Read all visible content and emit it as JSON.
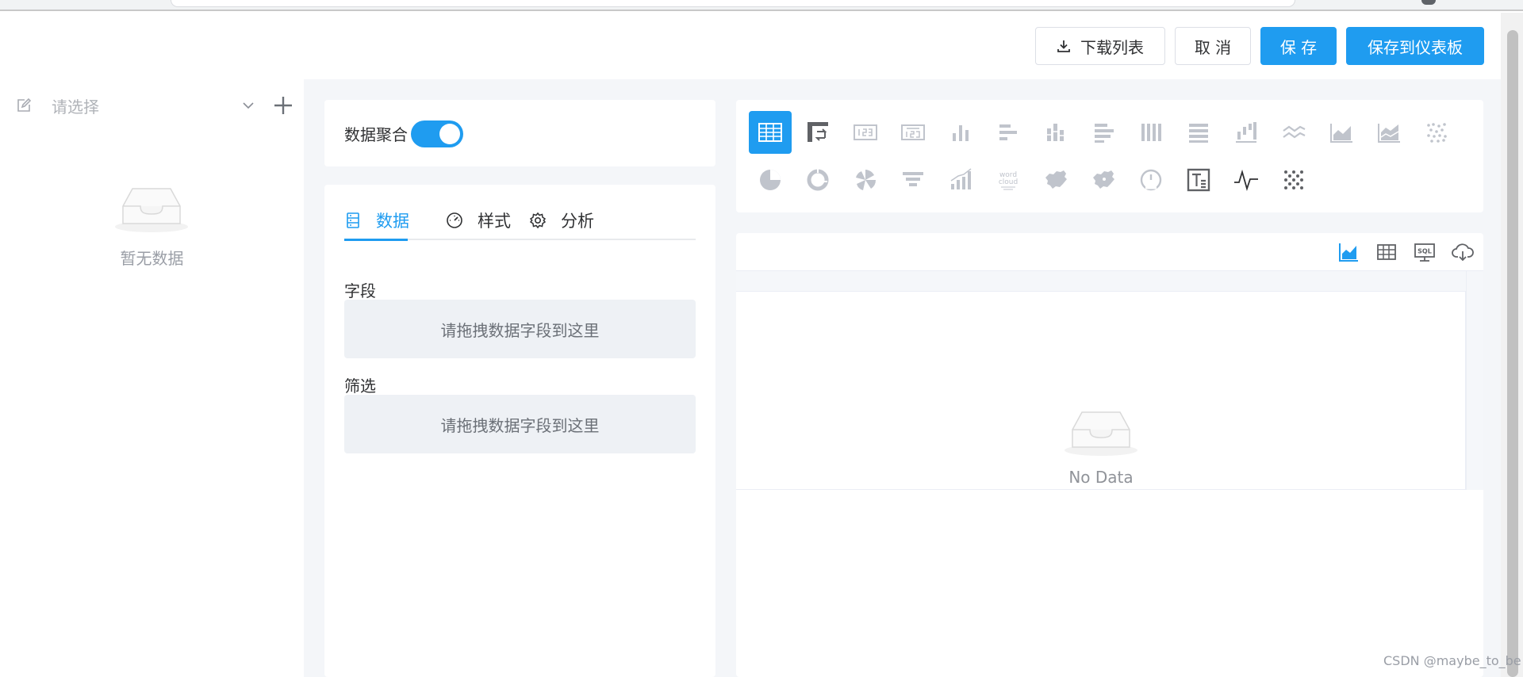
{
  "toolbar": {
    "download_label": "下载列表",
    "cancel_label": "取 消",
    "save_label": "保 存",
    "save_dashboard_label": "保存到仪表板"
  },
  "dataset": {
    "placeholder": "请选择",
    "empty_text": "暂无数据"
  },
  "aggregation": {
    "label": "数据聚合",
    "enabled": true
  },
  "config_tabs": [
    {
      "label": "数据",
      "icon": "database-icon",
      "active": true
    },
    {
      "label": "样式",
      "icon": "dashboard-gauge-icon",
      "active": false
    },
    {
      "label": "分析",
      "icon": "gear-icon",
      "active": false
    }
  ],
  "fields": {
    "field_label": "字段",
    "field_drop": "请拖拽数据字段到这里",
    "filter_label": "筛选",
    "filter_drop": "请拖拽数据字段到这里"
  },
  "chart_types": [
    {
      "icon": "table-icon",
      "active": true
    },
    {
      "icon": "pivot-table-icon"
    },
    {
      "icon": "kpi-number-icon"
    },
    {
      "icon": "kpi-compare-icon"
    },
    {
      "icon": "bar-chart-icon"
    },
    {
      "icon": "horizontal-bar-icon"
    },
    {
      "icon": "stacked-bar-icon"
    },
    {
      "icon": "horizontal-stacked-bar-icon"
    },
    {
      "icon": "percent-bar-icon"
    },
    {
      "icon": "horizontal-percent-bar-icon"
    },
    {
      "icon": "waterfall-icon"
    },
    {
      "icon": "line-chart-icon"
    },
    {
      "icon": "area-chart-icon"
    },
    {
      "icon": "stacked-area-icon"
    },
    {
      "icon": "scatter-icon"
    },
    {
      "icon": "pie-chart-icon"
    },
    {
      "icon": "donut-chart-icon"
    },
    {
      "icon": "rose-chart-icon"
    },
    {
      "icon": "funnel-icon"
    },
    {
      "icon": "combo-bar-line-icon"
    },
    {
      "icon": "word-cloud-icon",
      "text": "word cloud"
    },
    {
      "icon": "china-map-icon"
    },
    {
      "icon": "china-map-bubble-icon"
    },
    {
      "icon": "gauge-icon"
    },
    {
      "icon": "text-card-icon"
    },
    {
      "icon": "sparkline-icon"
    },
    {
      "icon": "dot-matrix-icon"
    }
  ],
  "preview": {
    "tools": [
      "chart-view-icon",
      "table-view-icon",
      "sql-icon",
      "cloud-download-icon"
    ],
    "no_data": "No Data"
  },
  "watermark": "CSDN @maybe_to_be",
  "colors": {
    "primary": "#1f9cf0",
    "workspace_bg": "#f4f6f9",
    "icon_inactive": "#c0c4cc",
    "icon_dark": "#606266"
  }
}
